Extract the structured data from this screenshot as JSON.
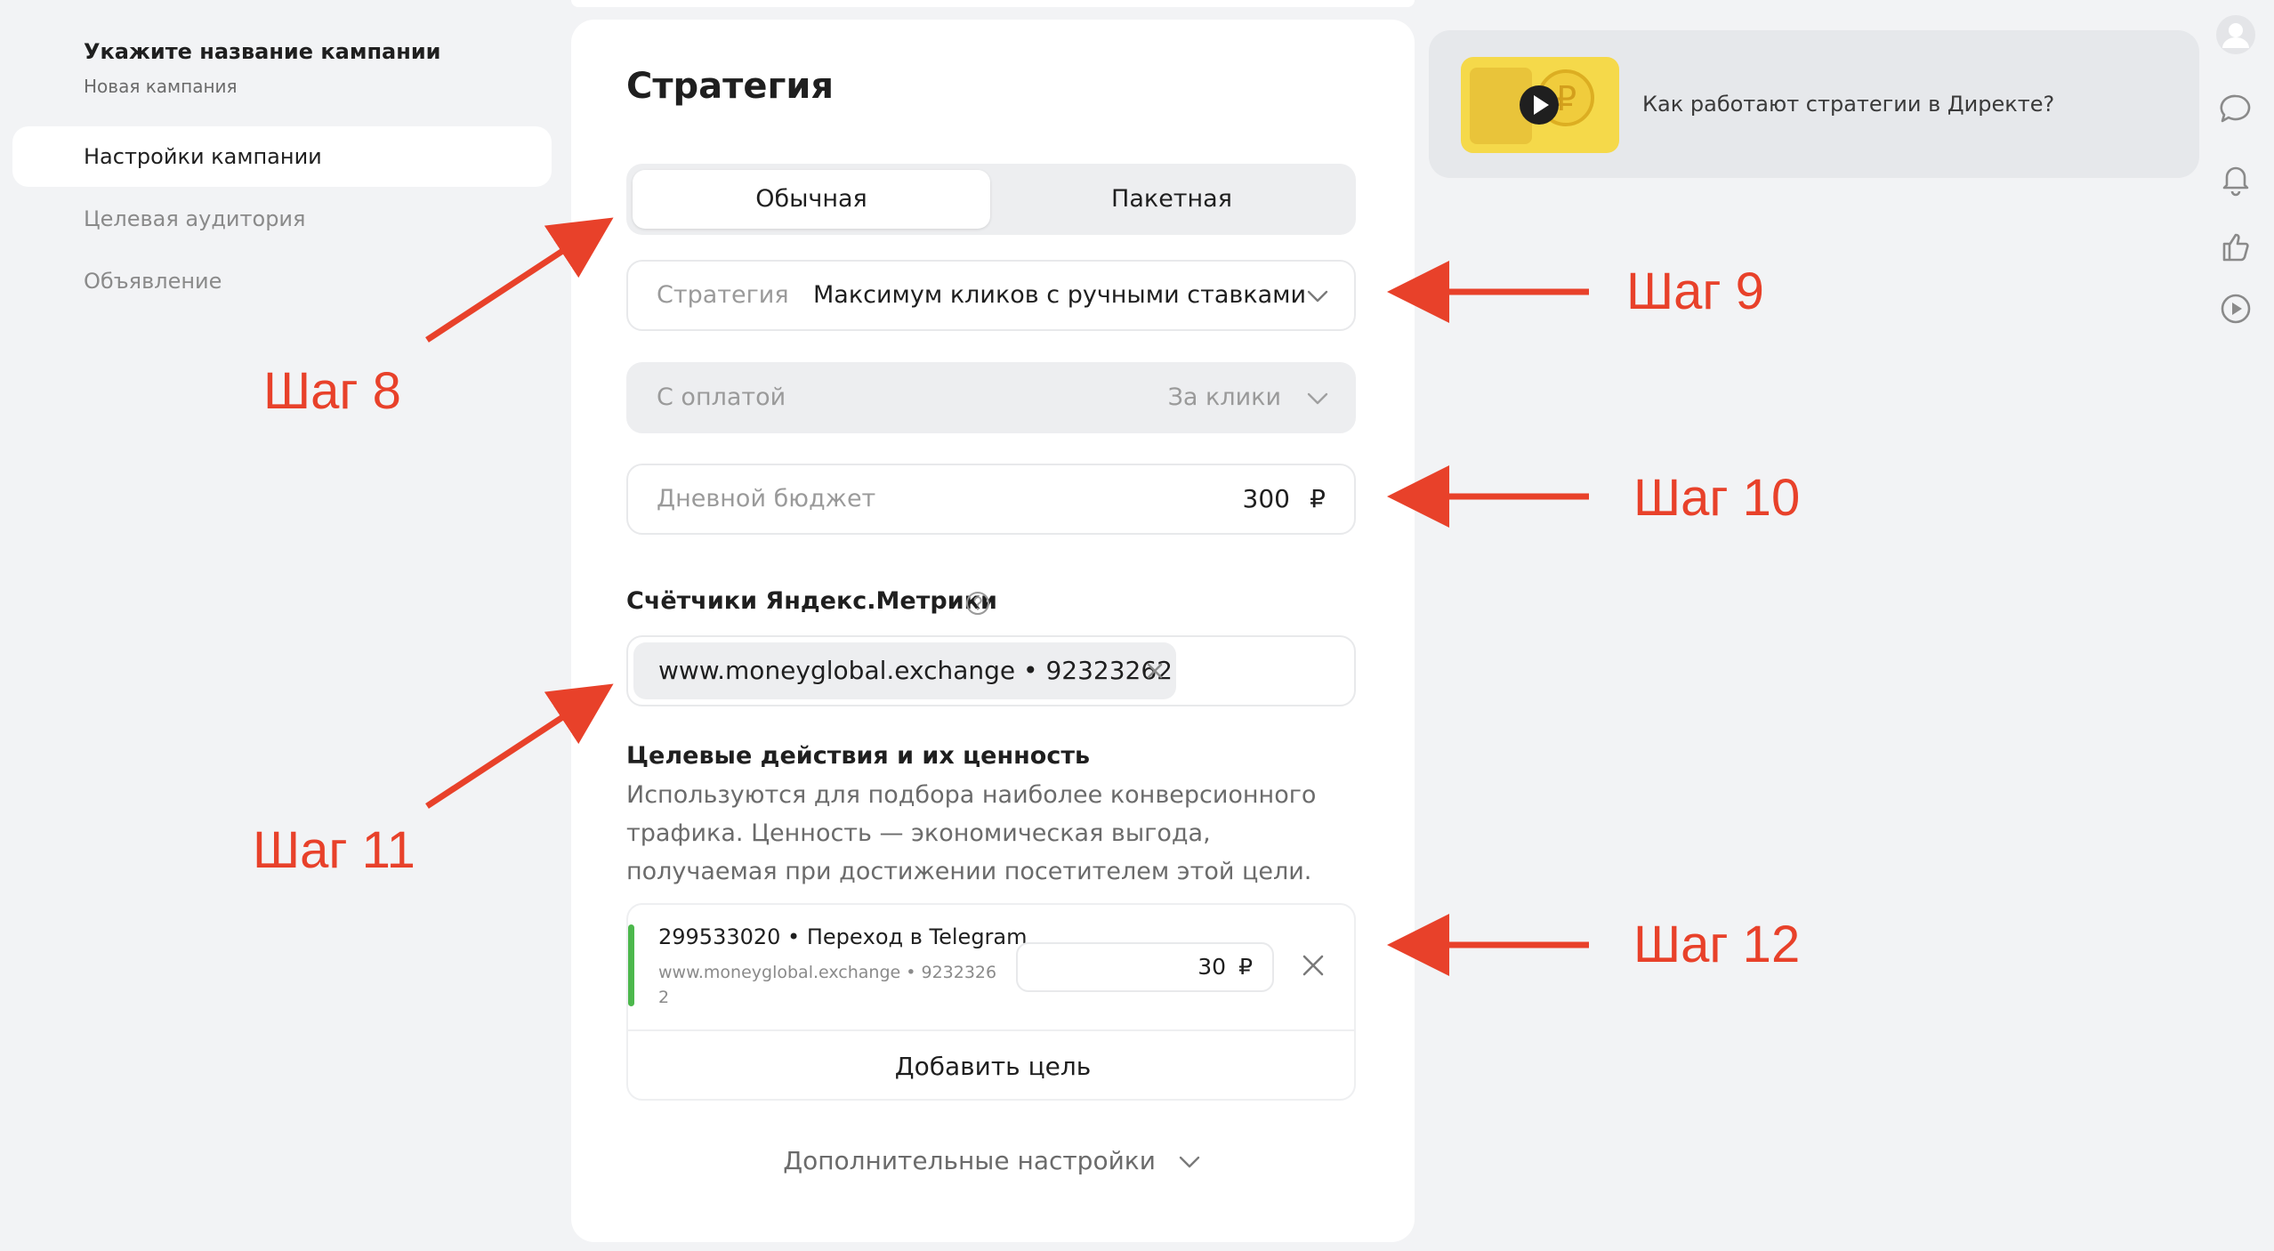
{
  "sidebar": {
    "title": "Укажите название кампании",
    "subtitle": "Новая кампания",
    "items": [
      {
        "label": "Настройки кампании"
      },
      {
        "label": "Целевая аудитория"
      },
      {
        "label": "Объявление"
      }
    ]
  },
  "main": {
    "title": "Стратегия",
    "tabs": [
      {
        "label": "Обычная"
      },
      {
        "label": "Пакетная"
      }
    ],
    "strategy": {
      "label": "Стратегия",
      "value": "Максимум кликов с ручными ставками"
    },
    "payment": {
      "label": "С оплатой",
      "value": "За клики"
    },
    "budget": {
      "label": "Дневной бюджет",
      "value": "300",
      "currency": "₽"
    },
    "metrika": {
      "title": "Счётчики Яндекс.Метрики",
      "tag": "www.moneyglobal.exchange • 92323262"
    },
    "goals": {
      "title": "Целевые действия и их ценность",
      "description": "Используются для подбора наиболее конверсионного трафика. Ценность — экономическая выгода, получаемая при достижении посетителем этой цели.",
      "item": {
        "name": "299533020 • Переход в Telegram",
        "sub": "www.moneyglobal.exchange • 92323262",
        "value": "30",
        "currency": "₽"
      },
      "add_label": "Добавить цель"
    },
    "extra_label": "Дополнительные настройки"
  },
  "promo": {
    "text": "Как работают стратегии в Директе?"
  },
  "annotations": {
    "step8": "Шаг 8",
    "step9": "Шаг 9",
    "step10": "Шаг 10",
    "step11": "Шаг 11",
    "step12": "Шаг 12"
  },
  "colors": {
    "accent_arrow": "#e8412a",
    "goal_bar": "#4cb84c",
    "background": "#f2f3f5"
  },
  "icons": [
    "avatar-icon",
    "chat-icon",
    "bell-icon",
    "thumbs-up-icon",
    "play-circle-icon"
  ]
}
